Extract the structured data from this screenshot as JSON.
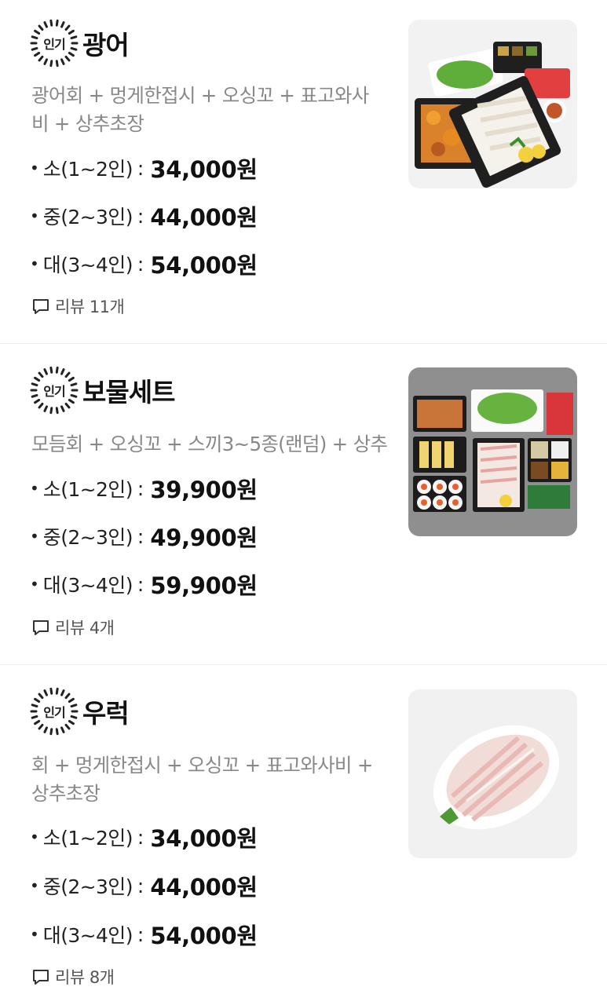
{
  "badge_label": "인기",
  "items": [
    {
      "title": "광어",
      "description": "광어회 + 멍게한접시 + 오싱꼬 + 표고와사비 + 상추초장",
      "prices": [
        {
          "size": "소(1~2인)",
          "price": "34,000원"
        },
        {
          "size": "중(2~3인)",
          "price": "44,000원"
        },
        {
          "size": "대(3~4인)",
          "price": "54,000원"
        }
      ],
      "review": "리뷰 11개",
      "image_icon": "sashimi-platter-photo"
    },
    {
      "title": "보물세트",
      "description": "모듬회 + 오싱꼬 + 스끼3~5종(랜덤) + 상추",
      "prices": [
        {
          "size": "소(1~2인)",
          "price": "39,900원"
        },
        {
          "size": "중(2~3인)",
          "price": "49,900원"
        },
        {
          "size": "대(3~4인)",
          "price": "59,900원"
        }
      ],
      "review": "리뷰 4개",
      "image_icon": "assorted-set-photo"
    },
    {
      "title": "우럭",
      "description": "회 + 멍게한접시 + 오싱꼬 + 표고와사비 + 상추초장",
      "prices": [
        {
          "size": "소(1~2인)",
          "price": "34,000원"
        },
        {
          "size": "중(2~3인)",
          "price": "44,000원"
        },
        {
          "size": "대(3~4인)",
          "price": "54,000원"
        }
      ],
      "review": "리뷰 8개",
      "image_icon": "rockfish-sashimi-photo"
    }
  ]
}
